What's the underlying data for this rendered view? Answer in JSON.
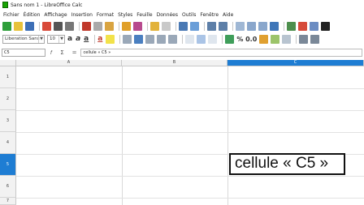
{
  "window": {
    "title": "Sans nom 1 - LibreOffice Calc"
  },
  "menu": [
    "Fichier",
    "Édition",
    "Affichage",
    "Insertion",
    "Format",
    "Styles",
    "Feuille",
    "Données",
    "Outils",
    "Fenêtre",
    "Aide"
  ],
  "format": {
    "font_name": "Liberation Sans",
    "font_size": "10",
    "number_format": "% 0.0"
  },
  "formula_bar": {
    "cell_ref": "C5",
    "content": "cellule « C5 »"
  },
  "grid": {
    "columns": [
      "A",
      "B",
      "C"
    ],
    "selected_column": "C",
    "rows": [
      "1",
      "2",
      "3",
      "4",
      "5",
      "6",
      "7"
    ],
    "selected_row": "5",
    "active_cell_value": "cellule « C5 »"
  },
  "colors": {
    "selection": "#1e7dd3",
    "app_icon": "#18a303"
  }
}
